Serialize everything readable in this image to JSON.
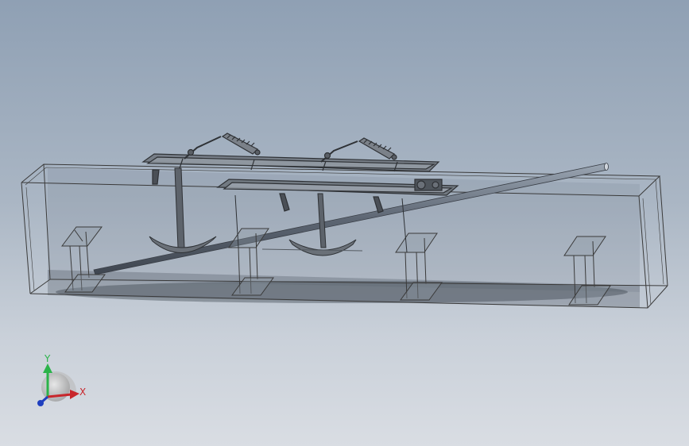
{
  "colors": {
    "background_top": "#8fa0b4",
    "background_bottom": "#d9dde3",
    "x_axis": "#c8262b",
    "y_axis": "#2bb34a",
    "z_axis": "#1f3fbf",
    "model_edges": "#3a3a3a"
  },
  "triad": {
    "x_label": "X",
    "y_label": "Y"
  }
}
